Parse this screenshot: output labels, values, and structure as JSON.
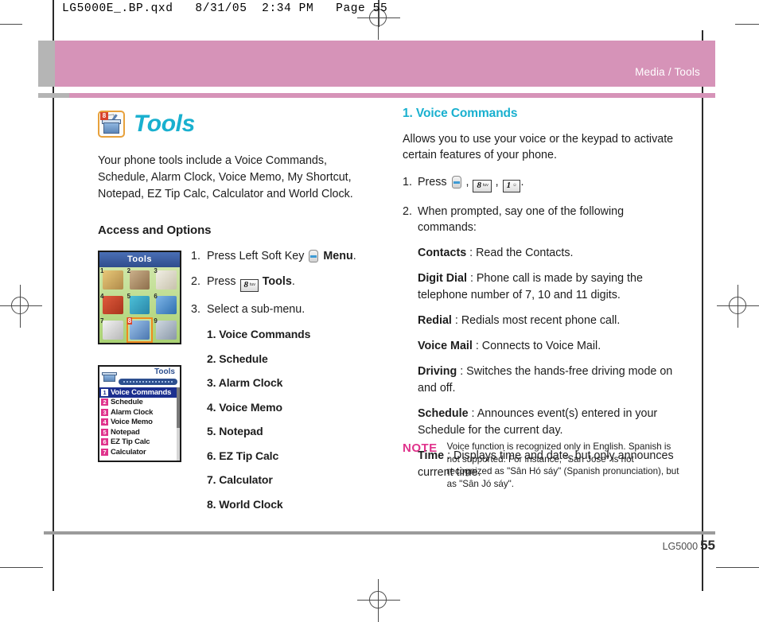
{
  "print_header": {
    "text": "LG5000E_.BP.qxd   8/31/05  2:34 PM   Page 55"
  },
  "masthead": {
    "breadcrumb": "Media / Tools"
  },
  "footer": {
    "model": "LG5000",
    "page_number": "55"
  },
  "section": {
    "title": "Tools",
    "icon_badge": "8",
    "intro": "Your phone tools include a Voice Commands, Schedule, Alarm Clock, Voice Memo, My Shortcut, Notepad, EZ Tip Calc, Calculator and World Clock.",
    "sub_head": "Access and Options"
  },
  "phone_shots": {
    "grid": {
      "title": "Tools",
      "cells": [
        {
          "num": "1",
          "selected": false,
          "color1": "#e8c878",
          "color2": "#b08a4a"
        },
        {
          "num": "2",
          "selected": false,
          "color1": "#cbb08a",
          "color2": "#8e6f4c"
        },
        {
          "num": "3",
          "selected": false,
          "color1": "#f0eee4",
          "color2": "#c8c2ac"
        },
        {
          "num": "4",
          "selected": false,
          "color1": "#e05a3c",
          "color2": "#a8331c"
        },
        {
          "num": "5",
          "selected": false,
          "color1": "#4cc0d8",
          "color2": "#2a86a8"
        },
        {
          "num": "6",
          "selected": false,
          "color1": "#7fb6e8",
          "color2": "#2f6fb0"
        },
        {
          "num": "7",
          "selected": false,
          "color1": "#f2f2f2",
          "color2": "#b8b8b8"
        },
        {
          "num": "8",
          "selected": true,
          "color1": "#9cc2ea",
          "color2": "#4b77b0"
        },
        {
          "num": "9",
          "selected": false,
          "color1": "#cfd8e0",
          "color2": "#8a98a8"
        }
      ]
    },
    "list": {
      "title": "Tools",
      "rows": [
        {
          "num": "1",
          "label": "Voice Commands",
          "selected": true
        },
        {
          "num": "2",
          "label": "Schedule",
          "selected": false
        },
        {
          "num": "3",
          "label": "Alarm Clock",
          "selected": false
        },
        {
          "num": "4",
          "label": "Voice Memo",
          "selected": false
        },
        {
          "num": "5",
          "label": "Notepad",
          "selected": false
        },
        {
          "num": "6",
          "label": "EZ Tip Calc",
          "selected": false
        },
        {
          "num": "7",
          "label": "Calculator",
          "selected": false
        }
      ]
    }
  },
  "access_steps": {
    "step1": {
      "index": "1.",
      "pre": "Press Left Soft Key",
      "bold": "Menu",
      "post": "."
    },
    "step2": {
      "index": "2.",
      "pre": "Press",
      "key_digit": "8",
      "key_sub": "tuv",
      "bold": "Tools",
      "post": "."
    },
    "step3": {
      "index": "3.",
      "text": "Select a sub-menu."
    },
    "submenu": [
      "1. Voice Commands",
      "2. Schedule",
      "3. Alarm Clock",
      "4. Voice Memo",
      "5. Notepad",
      "6. EZ Tip Calc",
      "7. Calculator",
      "8. World Clock"
    ]
  },
  "voice_commands": {
    "heading": "1. Voice Commands",
    "intro": "Allows you to use your voice or the keypad to activate certain features of your phone.",
    "step1": {
      "index": "1.",
      "pre": "Press",
      "key1_digit": "8",
      "key1_sub": "tuv",
      "key2_digit": "1",
      "key2_sub": "☺",
      "post": "."
    },
    "step2": {
      "index": "2.",
      "text": "When prompted, say one of the following commands:"
    },
    "definitions": [
      {
        "term": "Contacts",
        "desc": ": Read the Contacts."
      },
      {
        "term": "Digit Dial",
        "desc": ": Phone call is made by saying the telephone number of 7, 10 and 11 digits."
      },
      {
        "term": "Redial",
        "desc": ": Redials most recent phone call."
      },
      {
        "term": "Voice Mail",
        "desc": ": Connects to Voice Mail."
      },
      {
        "term": "Driving",
        "desc": ": Switches the hands-free driving mode on and off."
      },
      {
        "term": "Schedule",
        "desc": ": Announces event(s) entered in your Schedule for the current day."
      },
      {
        "term": "Time",
        "desc": ": Displays time and date, but only announces current time."
      }
    ]
  },
  "note": {
    "label": "NOTE",
    "body": "Voice function is recognized only in English. Spanish is not supported. For instance, \"San Jose\" is not recognized as \"Sân  Hó  sáy\" (Spanish pronunciation), but as \"Sân  Jó  sáy\"."
  },
  "colors": {
    "accent_teal": "#19b0cf",
    "masthead_pink": "#d693b8",
    "note_pink": "#e0338c",
    "gray_block": "#b5b5b5"
  }
}
